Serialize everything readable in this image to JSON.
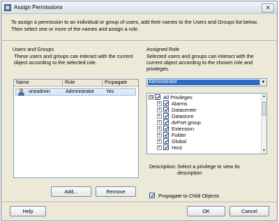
{
  "window": {
    "title": "Assign Permissions",
    "close_glyph": "✕",
    "icon": "app-icon"
  },
  "intro": "To assign a permission to an individual or group of users, add their names to the Users and Groups list below. Then select one or more of the names and assign a role.",
  "users_groups": {
    "title": "Users and Groups",
    "description": "These users and groups can interact with the current object according to the selected role.",
    "columns": [
      "Name",
      "Role",
      "Propagate"
    ],
    "rows": [
      {
        "name": "oneadmin",
        "role": "Administrator",
        "propagate": "Yes",
        "icon": "user-icon"
      }
    ],
    "add_button": "Add...",
    "remove_button": "Remove"
  },
  "assigned_role": {
    "title": "Assigned Role",
    "description": "Selected users and groups can interact with the current object according to the chosen role and privileges.",
    "selected_role": "Administrator",
    "dropdown_arrow": "▼",
    "privileges": [
      {
        "label": "All Privileges",
        "expander": "⊟",
        "checked": true
      },
      {
        "label": "Alarms",
        "expander": "+",
        "checked": true
      },
      {
        "label": "Datacenter",
        "expander": "+",
        "checked": true
      },
      {
        "label": "Datastore",
        "expander": "+",
        "checked": true
      },
      {
        "label": "dvPort group",
        "expander": "+",
        "checked": true
      },
      {
        "label": "Extension",
        "expander": "+",
        "checked": true
      },
      {
        "label": "Folder",
        "expander": "+",
        "checked": true
      },
      {
        "label": "Global",
        "expander": "+",
        "checked": true
      },
      {
        "label": "Host",
        "expander": "+",
        "checked": true
      }
    ],
    "scroll_up": "▲",
    "scroll_down": "▼",
    "description_label": "Description:",
    "description_text": "Select a privilege to view its description",
    "propagate_label": "Propagate to Child Objects",
    "propagate_checked": true
  },
  "footer": {
    "help_button": "Help",
    "ok_button": "OK",
    "cancel_button": "Cancel"
  }
}
